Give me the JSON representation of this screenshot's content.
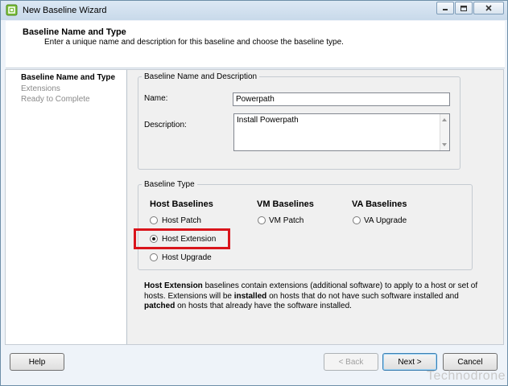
{
  "window": {
    "title": "New Baseline Wizard",
    "controls": {
      "minimize": "minimize-icon",
      "maximize": "maximize-icon",
      "close": "close-icon"
    }
  },
  "header": {
    "title": "Baseline Name and Type",
    "subtitle": "Enter a unique name and description for this baseline and choose the baseline type."
  },
  "nav": {
    "items": [
      {
        "label": "Baseline Name and Type",
        "active": true
      },
      {
        "label": "Extensions",
        "active": false
      },
      {
        "label": "Ready to Complete",
        "active": false
      }
    ]
  },
  "name_group": {
    "legend": "Baseline Name and Description",
    "name_label": "Name:",
    "name_value": "Powerpath",
    "description_label": "Description:",
    "description_value": "Install Powerpath"
  },
  "type_group": {
    "legend": "Baseline Type",
    "columns": [
      {
        "heading": "Host Baselines",
        "options": [
          {
            "label": "Host Patch",
            "checked": false
          },
          {
            "label": "Host Extension",
            "checked": true
          },
          {
            "label": "Host Upgrade",
            "checked": false
          }
        ]
      },
      {
        "heading": "VM Baselines",
        "options": [
          {
            "label": "VM Patch",
            "checked": false
          }
        ]
      },
      {
        "heading": "VA Baselines",
        "options": [
          {
            "label": "VA Upgrade",
            "checked": false
          }
        ]
      }
    ],
    "highlight_color": "#d9141b"
  },
  "description_text": {
    "p1_bold": "Host Extension",
    "p1_a": " baselines contain extensions (additional software) to apply to a host or set of hosts. Extensions will be ",
    "p1_bold2": "installed",
    "p1_b": " on hosts that do not have such software installed and ",
    "p1_bold3": "patched",
    "p1_c": " on hosts that already have the software installed."
  },
  "buttons": {
    "help": "Help",
    "back": "< Back",
    "next": "Next >",
    "cancel": "Cancel"
  },
  "watermark": "Technodrone"
}
